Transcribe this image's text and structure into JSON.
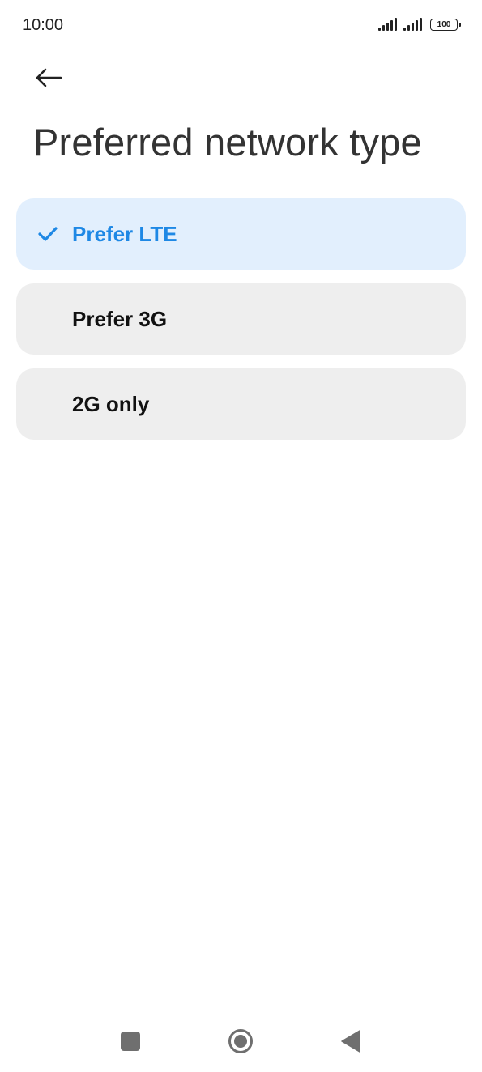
{
  "status_bar": {
    "time": "10:00",
    "battery": "100"
  },
  "header": {
    "back_icon": "arrow-left-icon",
    "title": "Preferred network type"
  },
  "options": [
    {
      "label": "Prefer LTE",
      "selected": true
    },
    {
      "label": "Prefer 3G",
      "selected": false
    },
    {
      "label": "2G only",
      "selected": false
    }
  ],
  "colors": {
    "accent": "#1e88e5",
    "selected_bg": "#e2effd",
    "option_bg": "#eeeeee"
  },
  "nav_bar": {
    "recents_icon": "square-icon",
    "home_icon": "circle-icon",
    "back_icon": "triangle-back-icon"
  }
}
